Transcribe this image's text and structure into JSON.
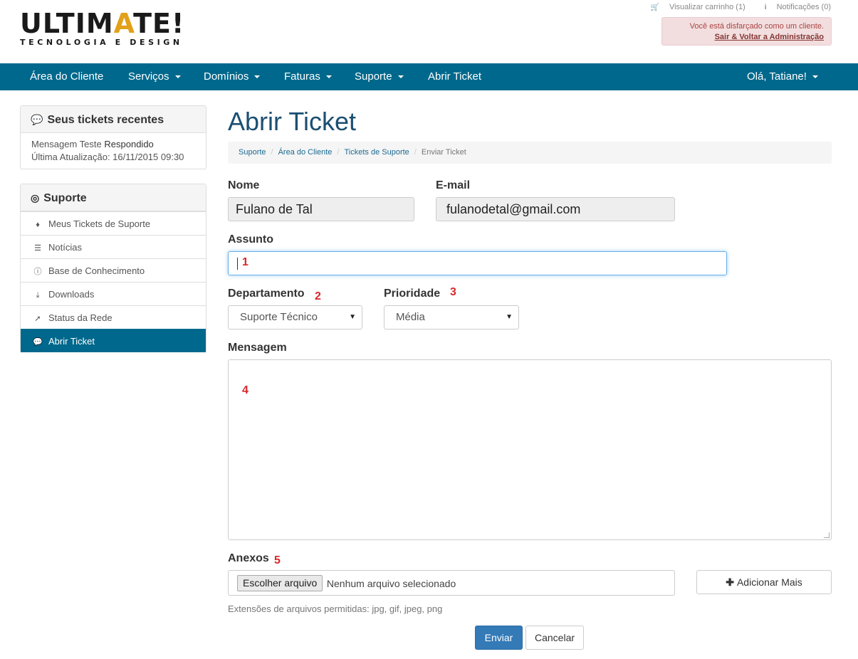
{
  "logo": {
    "main_part1": "ULTIM",
    "main_accent": "A",
    "main_part2": "TE!",
    "sub": "TECNOLOGIA E DESIGN"
  },
  "top_links": {
    "cart": "Visualizar carrinho (1)",
    "notifications": "Notificações (0)"
  },
  "disguise": {
    "text": "Você está disfarçado como um cliente.",
    "link": "Sair & Voltar a Administração"
  },
  "nav": {
    "items": [
      {
        "label": "Área do Cliente"
      },
      {
        "label": "Serviços"
      },
      {
        "label": "Domínios"
      },
      {
        "label": "Faturas"
      },
      {
        "label": "Suporte"
      },
      {
        "label": "Abrir Ticket"
      }
    ],
    "user": "Olá, Tatiane!"
  },
  "recent": {
    "title": "Seus tickets recentes",
    "ticket_subject": "Mensagem Teste",
    "ticket_status": "Respondido",
    "last_update": "Última Atualização: 16/11/2015 09:30"
  },
  "support": {
    "title": "Suporte",
    "items": [
      {
        "label": "Meus Tickets de Suporte",
        "icon": "ticket-icon"
      },
      {
        "label": "Notícias",
        "icon": "list-icon"
      },
      {
        "label": "Base de Conhecimento",
        "icon": "info-icon"
      },
      {
        "label": "Downloads",
        "icon": "download-icon"
      },
      {
        "label": "Status da Rede",
        "icon": "rocket-icon"
      },
      {
        "label": "Abrir Ticket",
        "icon": "comments-icon"
      }
    ]
  },
  "page": {
    "title": "Abrir Ticket"
  },
  "breadcrumb": [
    "Suporte",
    "Área do Cliente",
    "Tickets de Suporte",
    "Enviar Ticket"
  ],
  "form": {
    "name_label": "Nome",
    "name_value": "Fulano de Tal",
    "email_label": "E-mail",
    "email_value": "fulanodetal@gmail.com",
    "subject_label": "Assunto",
    "department_label": "Departamento",
    "department_value": "Suporte Técnico",
    "priority_label": "Prioridade",
    "priority_value": "Média",
    "message_label": "Mensagem",
    "attachments_label": "Anexos",
    "file_button": "Escolher arquivo",
    "file_none": "Nenhum arquivo selecionado",
    "add_more": "Adicionar Mais",
    "allowed_ext": "Extensões de arquivos permitidas: jpg, gif, jpeg, png",
    "submit": "Enviar",
    "cancel": "Cancelar"
  },
  "markers": [
    "1",
    "2",
    "3",
    "4",
    "5"
  ],
  "colors": {
    "nav": "#00688c",
    "primary": "#337ab7",
    "marker": "#d9262b",
    "logo_accent": "#e2a11b"
  }
}
